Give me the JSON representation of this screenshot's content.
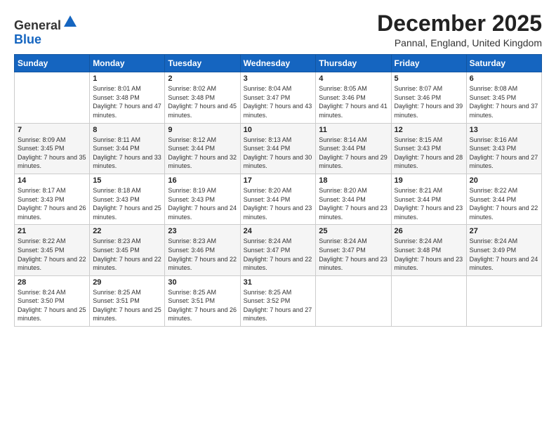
{
  "logo": {
    "general": "General",
    "blue": "Blue"
  },
  "header": {
    "month": "December 2025",
    "location": "Pannal, England, United Kingdom"
  },
  "days_of_week": [
    "Sunday",
    "Monday",
    "Tuesday",
    "Wednesday",
    "Thursday",
    "Friday",
    "Saturday"
  ],
  "weeks": [
    [
      {
        "day": "",
        "sunrise": "",
        "sunset": "",
        "daylight": ""
      },
      {
        "day": "1",
        "sunrise": "Sunrise: 8:01 AM",
        "sunset": "Sunset: 3:48 PM",
        "daylight": "Daylight: 7 hours and 47 minutes."
      },
      {
        "day": "2",
        "sunrise": "Sunrise: 8:02 AM",
        "sunset": "Sunset: 3:48 PM",
        "daylight": "Daylight: 7 hours and 45 minutes."
      },
      {
        "day": "3",
        "sunrise": "Sunrise: 8:04 AM",
        "sunset": "Sunset: 3:47 PM",
        "daylight": "Daylight: 7 hours and 43 minutes."
      },
      {
        "day": "4",
        "sunrise": "Sunrise: 8:05 AM",
        "sunset": "Sunset: 3:46 PM",
        "daylight": "Daylight: 7 hours and 41 minutes."
      },
      {
        "day": "5",
        "sunrise": "Sunrise: 8:07 AM",
        "sunset": "Sunset: 3:46 PM",
        "daylight": "Daylight: 7 hours and 39 minutes."
      },
      {
        "day": "6",
        "sunrise": "Sunrise: 8:08 AM",
        "sunset": "Sunset: 3:45 PM",
        "daylight": "Daylight: 7 hours and 37 minutes."
      }
    ],
    [
      {
        "day": "7",
        "sunrise": "Sunrise: 8:09 AM",
        "sunset": "Sunset: 3:45 PM",
        "daylight": "Daylight: 7 hours and 35 minutes."
      },
      {
        "day": "8",
        "sunrise": "Sunrise: 8:11 AM",
        "sunset": "Sunset: 3:44 PM",
        "daylight": "Daylight: 7 hours and 33 minutes."
      },
      {
        "day": "9",
        "sunrise": "Sunrise: 8:12 AM",
        "sunset": "Sunset: 3:44 PM",
        "daylight": "Daylight: 7 hours and 32 minutes."
      },
      {
        "day": "10",
        "sunrise": "Sunrise: 8:13 AM",
        "sunset": "Sunset: 3:44 PM",
        "daylight": "Daylight: 7 hours and 30 minutes."
      },
      {
        "day": "11",
        "sunrise": "Sunrise: 8:14 AM",
        "sunset": "Sunset: 3:44 PM",
        "daylight": "Daylight: 7 hours and 29 minutes."
      },
      {
        "day": "12",
        "sunrise": "Sunrise: 8:15 AM",
        "sunset": "Sunset: 3:43 PM",
        "daylight": "Daylight: 7 hours and 28 minutes."
      },
      {
        "day": "13",
        "sunrise": "Sunrise: 8:16 AM",
        "sunset": "Sunset: 3:43 PM",
        "daylight": "Daylight: 7 hours and 27 minutes."
      }
    ],
    [
      {
        "day": "14",
        "sunrise": "Sunrise: 8:17 AM",
        "sunset": "Sunset: 3:43 PM",
        "daylight": "Daylight: 7 hours and 26 minutes."
      },
      {
        "day": "15",
        "sunrise": "Sunrise: 8:18 AM",
        "sunset": "Sunset: 3:43 PM",
        "daylight": "Daylight: 7 hours and 25 minutes."
      },
      {
        "day": "16",
        "sunrise": "Sunrise: 8:19 AM",
        "sunset": "Sunset: 3:43 PM",
        "daylight": "Daylight: 7 hours and 24 minutes."
      },
      {
        "day": "17",
        "sunrise": "Sunrise: 8:20 AM",
        "sunset": "Sunset: 3:44 PM",
        "daylight": "Daylight: 7 hours and 23 minutes."
      },
      {
        "day": "18",
        "sunrise": "Sunrise: 8:20 AM",
        "sunset": "Sunset: 3:44 PM",
        "daylight": "Daylight: 7 hours and 23 minutes."
      },
      {
        "day": "19",
        "sunrise": "Sunrise: 8:21 AM",
        "sunset": "Sunset: 3:44 PM",
        "daylight": "Daylight: 7 hours and 23 minutes."
      },
      {
        "day": "20",
        "sunrise": "Sunrise: 8:22 AM",
        "sunset": "Sunset: 3:44 PM",
        "daylight": "Daylight: 7 hours and 22 minutes."
      }
    ],
    [
      {
        "day": "21",
        "sunrise": "Sunrise: 8:22 AM",
        "sunset": "Sunset: 3:45 PM",
        "daylight": "Daylight: 7 hours and 22 minutes."
      },
      {
        "day": "22",
        "sunrise": "Sunrise: 8:23 AM",
        "sunset": "Sunset: 3:45 PM",
        "daylight": "Daylight: 7 hours and 22 minutes."
      },
      {
        "day": "23",
        "sunrise": "Sunrise: 8:23 AM",
        "sunset": "Sunset: 3:46 PM",
        "daylight": "Daylight: 7 hours and 22 minutes."
      },
      {
        "day": "24",
        "sunrise": "Sunrise: 8:24 AM",
        "sunset": "Sunset: 3:47 PM",
        "daylight": "Daylight: 7 hours and 22 minutes."
      },
      {
        "day": "25",
        "sunrise": "Sunrise: 8:24 AM",
        "sunset": "Sunset: 3:47 PM",
        "daylight": "Daylight: 7 hours and 23 minutes."
      },
      {
        "day": "26",
        "sunrise": "Sunrise: 8:24 AM",
        "sunset": "Sunset: 3:48 PM",
        "daylight": "Daylight: 7 hours and 23 minutes."
      },
      {
        "day": "27",
        "sunrise": "Sunrise: 8:24 AM",
        "sunset": "Sunset: 3:49 PM",
        "daylight": "Daylight: 7 hours and 24 minutes."
      }
    ],
    [
      {
        "day": "28",
        "sunrise": "Sunrise: 8:24 AM",
        "sunset": "Sunset: 3:50 PM",
        "daylight": "Daylight: 7 hours and 25 minutes."
      },
      {
        "day": "29",
        "sunrise": "Sunrise: 8:25 AM",
        "sunset": "Sunset: 3:51 PM",
        "daylight": "Daylight: 7 hours and 25 minutes."
      },
      {
        "day": "30",
        "sunrise": "Sunrise: 8:25 AM",
        "sunset": "Sunset: 3:51 PM",
        "daylight": "Daylight: 7 hours and 26 minutes."
      },
      {
        "day": "31",
        "sunrise": "Sunrise: 8:25 AM",
        "sunset": "Sunset: 3:52 PM",
        "daylight": "Daylight: 7 hours and 27 minutes."
      },
      {
        "day": "",
        "sunrise": "",
        "sunset": "",
        "daylight": ""
      },
      {
        "day": "",
        "sunrise": "",
        "sunset": "",
        "daylight": ""
      },
      {
        "day": "",
        "sunrise": "",
        "sunset": "",
        "daylight": ""
      }
    ]
  ]
}
